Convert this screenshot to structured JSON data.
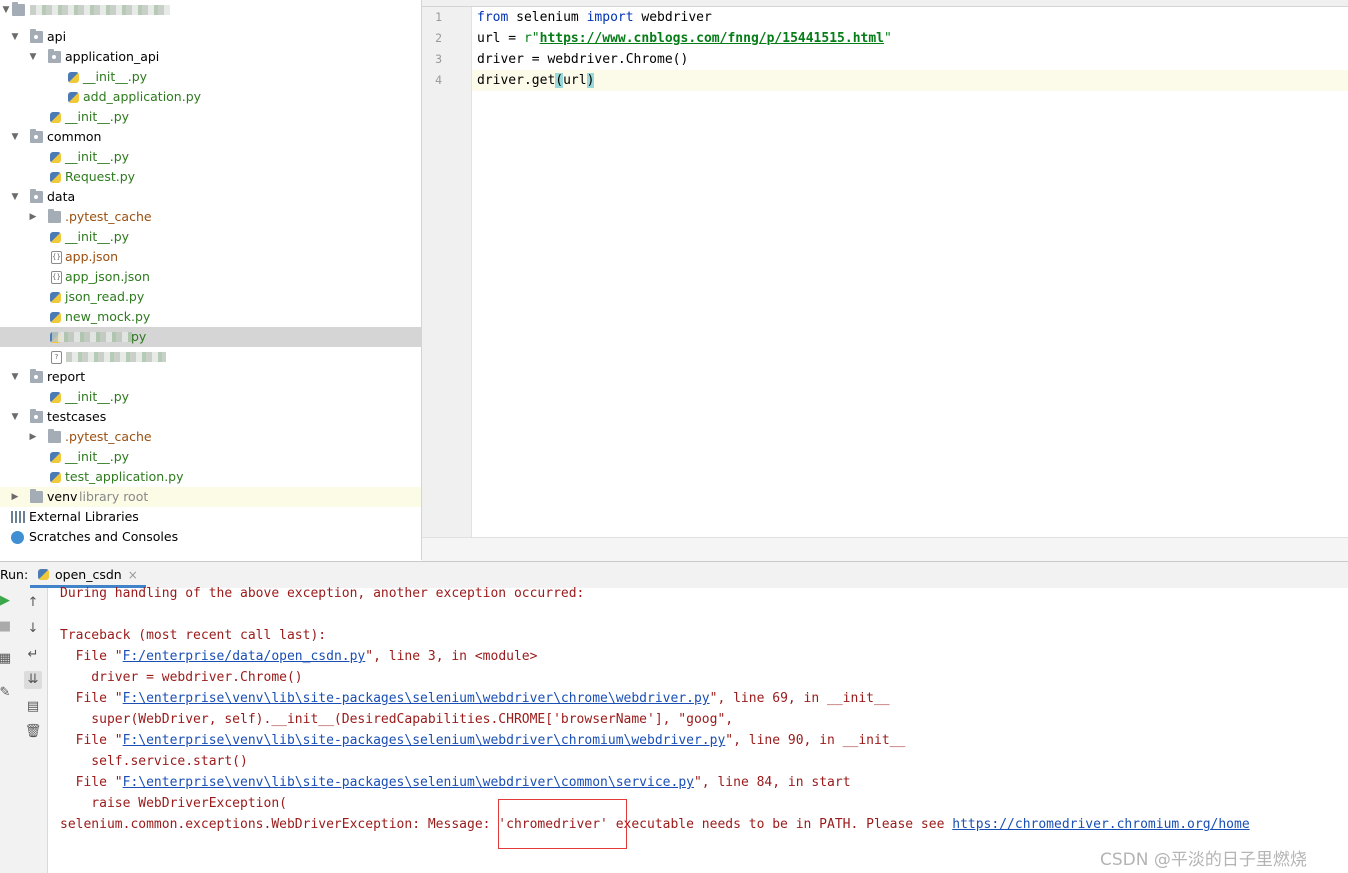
{
  "project_tree": {
    "items": [
      {
        "label": "api"
      },
      {
        "label": "application_api"
      },
      {
        "label": "__init__.py"
      },
      {
        "label": "add_application.py"
      },
      {
        "label": "__init__.py"
      },
      {
        "label": "common"
      },
      {
        "label": "__init__.py"
      },
      {
        "label": "Request.py"
      },
      {
        "label": "data"
      },
      {
        "label": ".pytest_cache"
      },
      {
        "label": "__init__.py"
      },
      {
        "label": "app.json"
      },
      {
        "label": "app_json.json"
      },
      {
        "label": "json_read.py"
      },
      {
        "label": "new_mock.py"
      },
      {
        "label": "report"
      },
      {
        "label": "__init__.py"
      },
      {
        "label": "testcases"
      },
      {
        "label": ".pytest_cache"
      },
      {
        "label": "__init__.py"
      },
      {
        "label": "test_application.py"
      },
      {
        "label": "venv"
      },
      {
        "label": "External Libraries"
      },
      {
        "label": "Scratches and Consoles"
      }
    ],
    "venv_hint": "library root",
    "selected_suffix": "py"
  },
  "editor": {
    "line_numbers": [
      "1",
      "2",
      "3",
      "4"
    ],
    "code": {
      "l1_from": "from",
      "l1_mod": " selenium ",
      "l1_import": "import",
      "l1_rest": " webdriver",
      "l2_pre": "url = ",
      "l2_r": "r\"",
      "l2_url": "https://www.cnblogs.com/fnng/p/15441515.html",
      "l2_q": "\"",
      "l3": "driver = webdriver.Chrome()",
      "l4_pre": "driver.get",
      "l4_open": "(",
      "l4_arg": "url",
      "l4_close": ")"
    }
  },
  "run": {
    "label": "Run:",
    "tab_name": "open_csdn",
    "tab_close": "×"
  },
  "console": {
    "l1": "During handling of the above exception, another exception occurred:",
    "l2": "Traceback (most recent call last):",
    "l3_pre": "  File \"",
    "l3_link": "F:/enterprise/data/open_csdn.py",
    "l3_post": "\", line 3, in <module>",
    "l4": "    driver = webdriver.Chrome()",
    "l5_pre": "  File \"",
    "l5_link": "F:\\enterprise\\venv\\lib\\site-packages\\selenium\\webdriver\\chrome\\webdriver.py",
    "l5_post": "\", line 69, in __init__",
    "l6": "    super(WebDriver, self).__init__(DesiredCapabilities.CHROME['browserName'], \"goog\",",
    "l7_pre": "  File \"",
    "l7_link": "F:\\enterprise\\venv\\lib\\site-packages\\selenium\\webdriver\\chromium\\webdriver.py",
    "l7_post": "\", line 90, in __init__",
    "l8": "    self.service.start()",
    "l9_pre": "  File \"",
    "l9_link": "F:\\enterprise\\venv\\lib\\site-packages\\selenium\\webdriver\\common\\service.py",
    "l9_post": "\", line 84, in start",
    "l10": "    raise WebDriverException(",
    "l11_pre": "selenium.common.exceptions.WebDriverException: Message: 'chromedriver' executable needs to be in PATH. Please see ",
    "l11_link": "https://chromedriver.chromium.org/home"
  },
  "watermark": "CSDN @平淡的日子里燃烧"
}
